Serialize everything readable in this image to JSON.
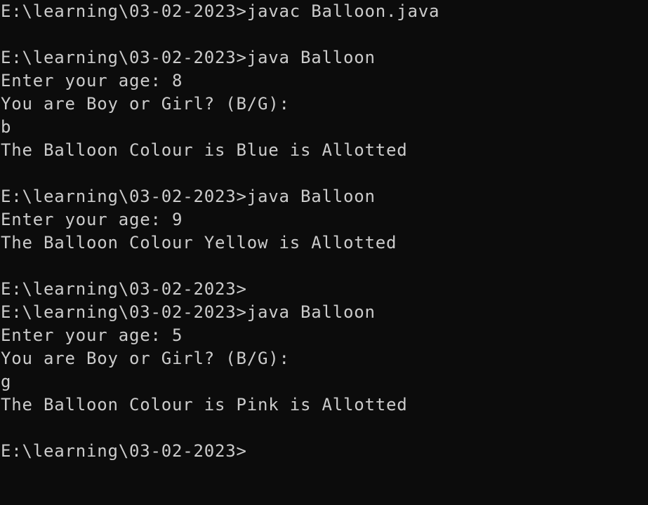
{
  "console": {
    "background": "#0c0c0c",
    "foreground": "#cccccc",
    "lines": [
      "E:\\learning\\03-02-2023>javac Balloon.java",
      "",
      "E:\\learning\\03-02-2023>java Balloon",
      "Enter your age: 8",
      "You are Boy or Girl? (B/G):",
      "b",
      "The Balloon Colour is Blue is Allotted",
      "",
      "E:\\learning\\03-02-2023>java Balloon",
      "Enter your age: 9",
      "The Balloon Colour Yellow is Allotted",
      "",
      "E:\\learning\\03-02-2023>",
      "E:\\learning\\03-02-2023>java Balloon",
      "Enter your age: 5",
      "You are Boy or Girl? (B/G):",
      "g",
      "The Balloon Colour is Pink is Allotted",
      "",
      "E:\\learning\\03-02-2023>"
    ]
  }
}
